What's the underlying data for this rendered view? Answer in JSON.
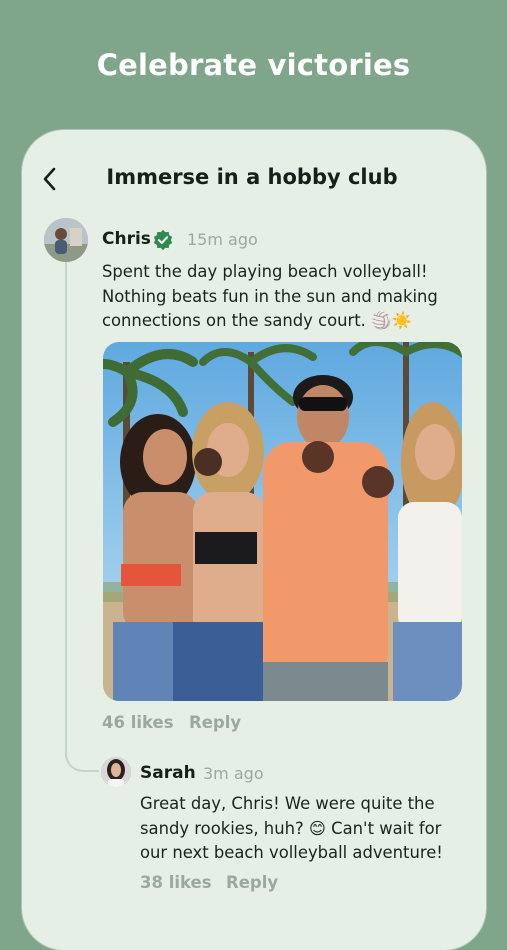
{
  "headline": "Celebrate victories",
  "screen": {
    "title": "Immerse in a hobby club"
  },
  "post": {
    "author": "Chris",
    "time": "15m ago",
    "text": "Spent the day playing beach volleyball!\nNothing beats fun in the sun and making\nconnections on the sandy court. 🏐☀️",
    "likes": "46 likes",
    "reply": "Reply"
  },
  "comment": {
    "author": "Sarah",
    "time": "3m ago",
    "text": "Great day, Chris! We were quite the\nsandy rookies, huh? 😊 Can't wait for\nour next beach volleyball adventure!",
    "likes": "38 likes",
    "reply": "Reply"
  },
  "colors": {
    "background": "#7fa58a",
    "card": "#e6efe6",
    "verified": "#2e8b4f",
    "muted": "#9aa9a0"
  }
}
